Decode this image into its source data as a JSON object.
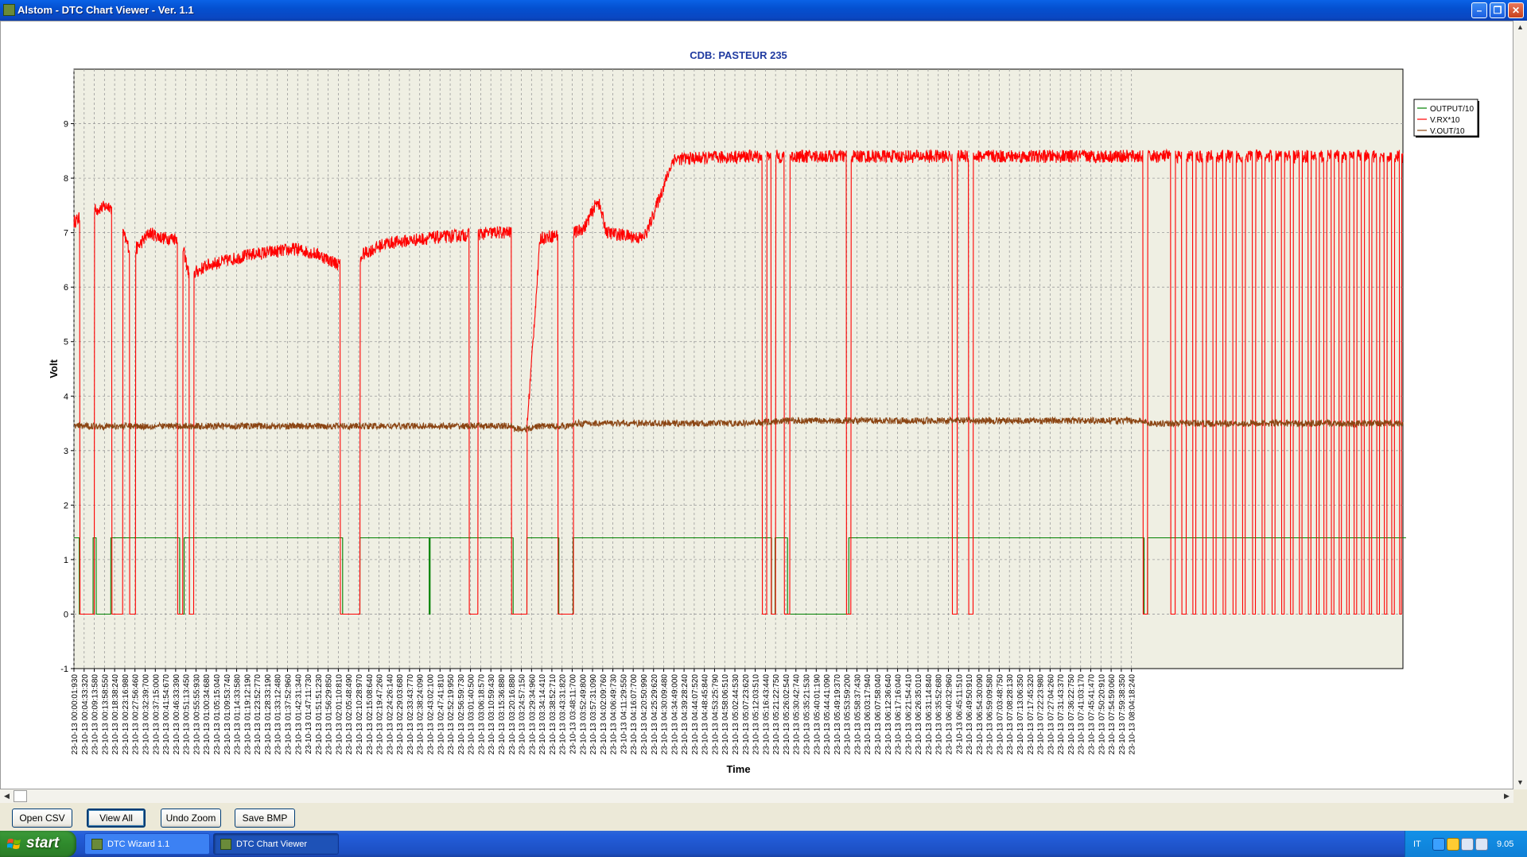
{
  "window": {
    "title": "Alstom - DTC Chart Viewer - Ver. 1.1",
    "icon": "app-icon"
  },
  "buttons": {
    "open_csv": "Open CSV",
    "view_all": "View All",
    "undo_zoom": "Undo Zoom",
    "save_bmp": "Save BMP"
  },
  "taskbar": {
    "start_label": "start",
    "tasks": [
      {
        "label": "DTC Wizard 1.1",
        "active": false
      },
      {
        "label": "DTC Chart Viewer",
        "active": true
      }
    ],
    "language": "IT",
    "clock": "9.05"
  },
  "chart_data": {
    "type": "line",
    "title": "CDB: PASTEUR 235",
    "xlabel": "Time",
    "ylabel": "Volt",
    "ylim": [
      -1,
      10
    ],
    "yticks": [
      -1,
      0,
      1,
      2,
      3,
      4,
      5,
      6,
      7,
      8,
      9
    ],
    "xlim": [
      0,
      29930
    ],
    "x_tick_step_seconds": 229,
    "date_prefix": "23-10-13",
    "x_tick_labels": [
      "00:00:01:930",
      "00:04:33:320",
      "00:09:13:580",
      "00:13:58:550",
      "00:18:38:240",
      "00:23:16:980",
      "00:27:56:460",
      "00:32:39:700",
      "00:37:15:000",
      "00:41:54:670",
      "00:46:33:390",
      "00:51:13:450",
      "00:55:55:930",
      "01:00:34:680",
      "01:05:15:040",
      "01:09:53:740",
      "01:14:33:580",
      "01:19:12:190",
      "01:23:52:770",
      "01:28:33:190",
      "01:33:12:480",
      "01:37:52:960",
      "01:42:31:340",
      "01:47:11:730",
      "01:51:51:230",
      "01:56:29:850",
      "02:01:10:810",
      "02:05:48:490",
      "02:10:28:970",
      "02:15:08:640",
      "02:19:47:260",
      "02:24:26:140",
      "02:29:03:680",
      "02:33:43:770",
      "02:38:24:090",
      "02:43:02:100",
      "02:47:41:810",
      "02:52:19:950",
      "02:56:59:730",
      "03:01:40:500",
      "03:06:18:570",
      "03:10:59:430",
      "03:15:36:880",
      "03:20:16:880",
      "03:24:57:150",
      "03:29:34:960",
      "03:34:14:410",
      "03:38:52:710",
      "03:43:31:820",
      "03:48:11:700",
      "03:52:49:800",
      "03:57:31:090",
      "04:02:09:760",
      "04:06:49:730",
      "04:11:29:550",
      "04:16:07:700",
      "04:20:50:990",
      "04:25:29:620",
      "04:30:09:480",
      "04:34:49:000",
      "04:39:28:240",
      "04:44:07:520",
      "04:48:45:840",
      "04:53:25:790",
      "04:58:06:510",
      "05:02:44:530",
      "05:07:23:620",
      "05:12:03:510",
      "05:16:43:440",
      "05:21:22:750",
      "05:26:02:540",
      "05:30:42:740",
      "05:35:21:530",
      "05:40:01:190",
      "05:44:41:090",
      "05:49:19:370",
      "05:53:59:200",
      "05:58:37:430",
      "06:03:17:940",
      "06:07:58:040",
      "06:12:36:640",
      "06:17:16:040",
      "06:21:54:410",
      "06:26:35:010",
      "06:31:14:840",
      "06:35:52:680",
      "06:40:32:960",
      "06:45:11:510",
      "06:49:50:910",
      "06:54:30:090",
      "06:59:09:580",
      "07:03:48:750",
      "07:08:28:130",
      "07:13:06:350",
      "07:17:45:320",
      "07:22:23:980",
      "07:27:04:260",
      "07:31:43:370",
      "07:36:22:750",
      "07:41:03:170",
      "07:45:41:470",
      "07:50:20:910",
      "07:54:59:060",
      "07:59:38:350",
      "08:04:18:240"
    ],
    "grid": true,
    "legend": {
      "position": "top-right"
    },
    "series": [
      {
        "name": "OUTPUT/10",
        "color": "#008000",
        "style": "step",
        "x": [
          0,
          120,
          121,
          430,
          431,
          500,
          501,
          830,
          831,
          2380,
          2381,
          2480,
          2481,
          6050,
          6051,
          6440,
          6441,
          8000,
          8001,
          8020,
          8021,
          9890,
          9891,
          10200,
          10201,
          10920,
          10921,
          11240,
          11241,
          15710,
          15711,
          15790,
          15791,
          16070,
          16071,
          17450,
          17451,
          24100,
          24101,
          24180,
          24181,
          30000
        ],
        "values": [
          1.4,
          1.4,
          0,
          0,
          1.4,
          1.4,
          0,
          0,
          1.4,
          1.4,
          0,
          0,
          1.4,
          1.4,
          0,
          0,
          1.4,
          1.4,
          0,
          0,
          1.4,
          1.4,
          0,
          0,
          1.4,
          1.4,
          0,
          0,
          1.4,
          1.4,
          0,
          0,
          1.4,
          1.4,
          0,
          0,
          1.4,
          1.4,
          0,
          0,
          1.4,
          1.4
        ]
      },
      {
        "name": "V.RX*10",
        "color": "#FF0000",
        "style": "noisy",
        "x": [
          0,
          400,
          800,
          1000,
          1100,
          1300,
          1500,
          1700,
          2000,
          2400,
          2600,
          3000,
          4000,
          5000,
          5500,
          6000,
          6300,
          6500,
          7000,
          8000,
          9500,
          9900,
          10000,
          10200,
          10500,
          11200,
          11300,
          11500,
          11800,
          12000,
          12800,
          12900,
          13500,
          15200,
          15600,
          16000,
          18000,
          30000
        ],
        "values": [
          7.2,
          7.4,
          7.5,
          7.2,
          7.0,
          6.6,
          6.8,
          7.0,
          6.9,
          6.9,
          6.2,
          6.4,
          6.6,
          6.7,
          6.6,
          6.4,
          6.0,
          6.6,
          6.8,
          6.9,
          7.0,
          7.0,
          3.4,
          3.4,
          6.9,
          7.0,
          7.0,
          7.1,
          7.6,
          7.0,
          6.9,
          7.0,
          8.35,
          8.4,
          8.4,
          8.4,
          8.4,
          8.4
        ],
        "noise": 0.12,
        "dropouts": [
          [
            130,
            460
          ],
          [
            850,
            1100
          ],
          [
            1250,
            1390
          ],
          [
            2330,
            2450
          ],
          [
            2600,
            2700
          ],
          [
            6000,
            6440
          ],
          [
            8900,
            9100
          ],
          [
            9850,
            10200
          ],
          [
            10900,
            11250
          ],
          [
            15500,
            15600
          ],
          [
            15700,
            15800
          ],
          [
            16000,
            16120
          ],
          [
            17400,
            17500
          ],
          [
            19780,
            19890
          ],
          [
            20150,
            20250
          ],
          [
            24080,
            24180
          ],
          [
            24700,
            24800
          ],
          [
            24950,
            25050
          ],
          [
            25200,
            25270
          ],
          [
            25420,
            25500
          ],
          [
            25650,
            25720
          ],
          [
            25880,
            25940
          ],
          [
            26100,
            26170
          ],
          [
            26320,
            26380
          ],
          [
            26540,
            26610
          ],
          [
            26760,
            26820
          ],
          [
            26980,
            27050
          ],
          [
            27200,
            27260
          ],
          [
            27400,
            27460
          ],
          [
            27600,
            27660
          ],
          [
            27800,
            27860
          ],
          [
            27980,
            28040
          ],
          [
            28150,
            28210
          ],
          [
            28320,
            28380
          ],
          [
            28490,
            28550
          ],
          [
            28660,
            28720
          ],
          [
            28830,
            28890
          ],
          [
            29000,
            29060
          ],
          [
            29170,
            29230
          ],
          [
            29340,
            29400
          ],
          [
            29510,
            29570
          ],
          [
            29680,
            29740
          ],
          [
            29850,
            29900
          ]
        ]
      },
      {
        "name": "V.OUT/10",
        "color": "#8B4513",
        "style": "noisy",
        "x": [
          0,
          9890,
          9900,
          10300,
          10400,
          11200,
          11300,
          15200,
          16000,
          24000,
          24200,
          30000
        ],
        "values": [
          3.45,
          3.45,
          3.4,
          3.4,
          3.45,
          3.45,
          3.5,
          3.5,
          3.55,
          3.55,
          3.5,
          3.5
        ],
        "noise": 0.06
      }
    ]
  }
}
